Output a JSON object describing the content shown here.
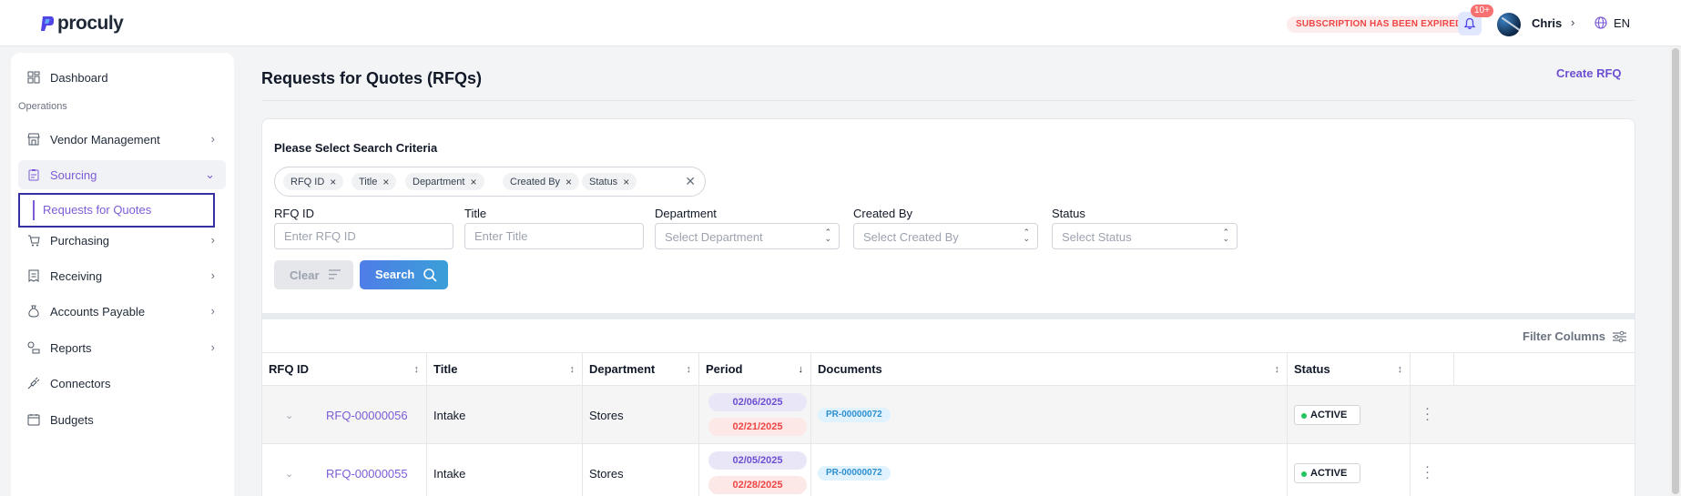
{
  "app": {
    "brand": "proculy"
  },
  "header": {
    "subscription_notice": "SUBSCRIPTION HAS BEEN EXPIRED",
    "notification_badge": "10+",
    "user_name": "Chris",
    "language": "EN"
  },
  "sidebar": {
    "section_operations": "Operations",
    "items": [
      {
        "label": "Dashboard",
        "icon": "dashboard-icon"
      },
      {
        "label": "Vendor Management",
        "icon": "store-icon"
      },
      {
        "label": "Sourcing",
        "icon": "clipboard-icon"
      },
      {
        "label": "Requests for Quotes"
      },
      {
        "label": "Purchasing",
        "icon": "cart-icon"
      },
      {
        "label": "Receiving",
        "icon": "receipt-icon"
      },
      {
        "label": "Accounts Payable",
        "icon": "money-bag-icon"
      },
      {
        "label": "Reports",
        "icon": "reports-icon"
      },
      {
        "label": "Connectors",
        "icon": "plug-icon"
      },
      {
        "label": "Budgets",
        "icon": "calendar-icon"
      }
    ]
  },
  "page": {
    "title": "Requests for Quotes (RFQs)",
    "create_label": "Create RFQ"
  },
  "search": {
    "title": "Please Select Search Criteria",
    "chips": [
      "RFQ ID",
      "Title",
      "Department",
      "Created By",
      "Status"
    ],
    "fields": {
      "rfq_id": {
        "label": "RFQ ID",
        "placeholder": "Enter RFQ ID"
      },
      "title": {
        "label": "Title",
        "placeholder": "Enter Title"
      },
      "department": {
        "label": "Department",
        "placeholder": "Select Department"
      },
      "created_by": {
        "label": "Created By",
        "placeholder": "Select Created By"
      },
      "status": {
        "label": "Status",
        "placeholder": "Select Status"
      }
    },
    "clear_label": "Clear",
    "search_label": "Search"
  },
  "table": {
    "filter_columns_label": "Filter Columns",
    "columns": [
      "RFQ ID",
      "Title",
      "Department",
      "Period",
      "Documents",
      "Status"
    ],
    "rows": [
      {
        "rfq_id": "RFQ-00000056",
        "title": "Intake",
        "department": "Stores",
        "start": "02/06/2025",
        "end": "02/21/2025",
        "document": "PR-00000072",
        "status": "ACTIVE"
      },
      {
        "rfq_id": "RFQ-00000055",
        "title": "Intake",
        "department": "Stores",
        "start": "02/05/2025",
        "end": "02/28/2025",
        "document": "PR-00000072",
        "status": "ACTIVE"
      }
    ]
  },
  "colors": {
    "accent": "#7c5cd6",
    "search_button": "#4f7de8",
    "expired_text": "#ef4444",
    "status_active_dot": "#22c55e"
  }
}
